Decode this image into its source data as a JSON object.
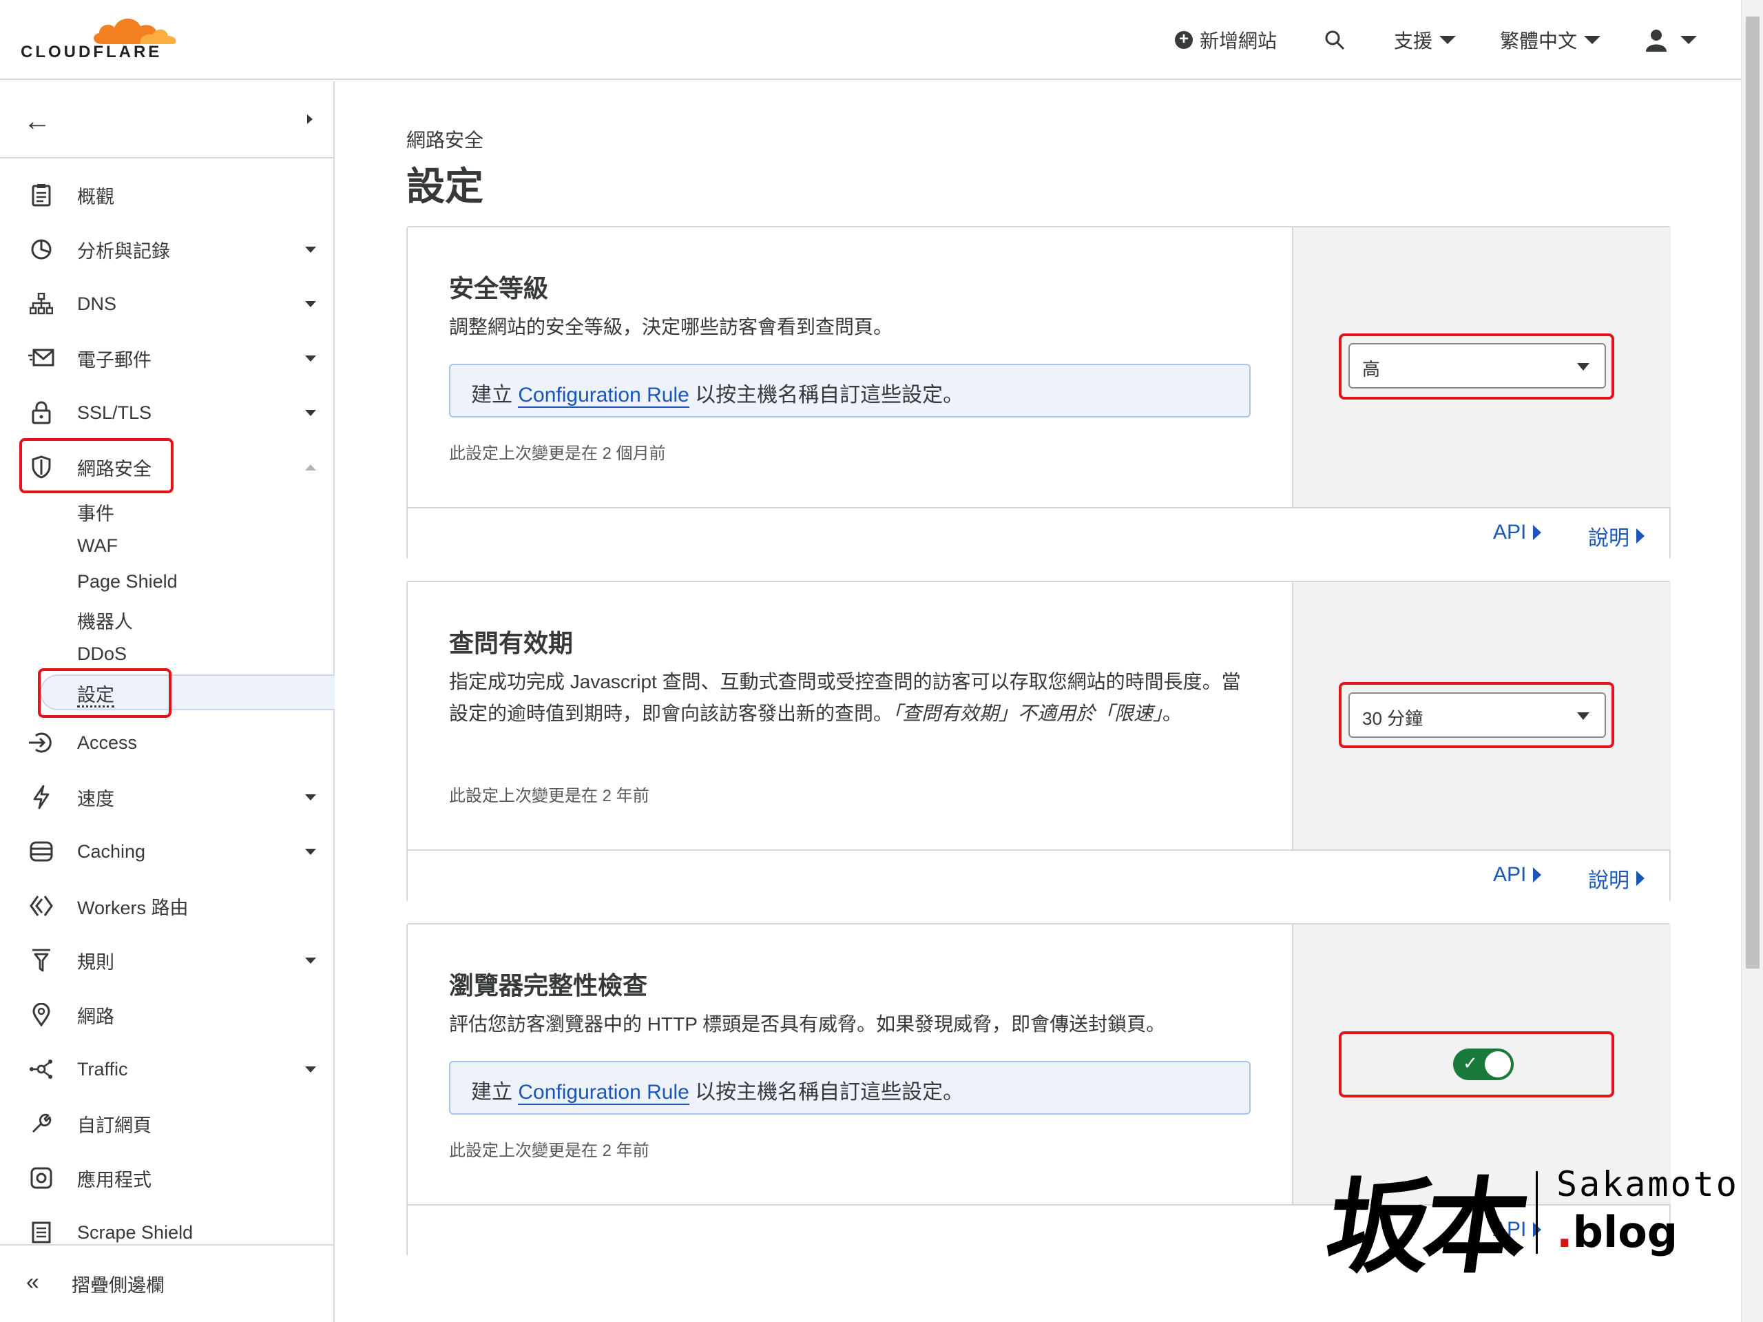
{
  "header": {
    "brand": "CLOUDFLARE",
    "add_site": "新增網站",
    "support": "支援",
    "language": "繁體中文"
  },
  "sidebar": {
    "items": [
      {
        "label": "概觀",
        "icon": "clipboard-icon"
      },
      {
        "label": "分析與記錄",
        "icon": "chart-pie-icon"
      },
      {
        "label": "DNS",
        "icon": "network-icon"
      },
      {
        "label": "電子郵件",
        "icon": "mail-icon"
      },
      {
        "label": "SSL/TLS",
        "icon": "lock-icon"
      },
      {
        "label": "網路安全",
        "icon": "shield-icon"
      },
      {
        "label": "Access",
        "icon": "access-icon"
      },
      {
        "label": "速度",
        "icon": "lightning-icon"
      },
      {
        "label": "Caching",
        "icon": "storage-icon"
      },
      {
        "label": "Workers 路由",
        "icon": "workers-icon"
      },
      {
        "label": "規則",
        "icon": "filter-icon"
      },
      {
        "label": "網路",
        "icon": "location-pin-icon"
      },
      {
        "label": "Traffic",
        "icon": "traffic-icon"
      },
      {
        "label": "自訂網頁",
        "icon": "wrench-icon"
      },
      {
        "label": "應用程式",
        "icon": "apps-icon"
      },
      {
        "label": "Scrape Shield",
        "icon": "document-icon"
      }
    ],
    "security_subitems": [
      "事件",
      "WAF",
      "Page Shield",
      "機器人",
      "DDoS",
      "設定"
    ],
    "collapse_label": "摺疊側邊欄"
  },
  "main": {
    "breadcrumb": "網路安全",
    "title": "設定",
    "cards": [
      {
        "title": "安全等級",
        "description": "調整網站的安全等級，決定哪些訪客會看到查問頁。",
        "info_prefix": "建立",
        "info_link": "Configuration Rule",
        "info_suffix": "以按主機名稱自訂這些設定。",
        "last_changed": "此設定上次變更是在 2 個月前",
        "control_value": "高",
        "api_label": "API",
        "help_label": "說明"
      },
      {
        "title": "查問有效期",
        "description": "指定成功完成 Javascript 查問、互動式查問或受控查問的訪客可以存取您網站的時間長度。當設定的逾時值到期時，即會向該訪客發出新的查問。",
        "description_italic": "「查問有效期」不適用於「限速」",
        "description_end": "。",
        "last_changed": "此設定上次變更是在 2 年前",
        "control_value": "30 分鐘",
        "api_label": "API",
        "help_label": "說明"
      },
      {
        "title": "瀏覽器完整性檢查",
        "description": "評估您訪客瀏覽器中的 HTTP 標頭是否具有威脅。如果發現威脅，即會傳送封鎖頁。",
        "info_prefix": "建立",
        "info_link": "Configuration Rule",
        "info_suffix": "以按主機名稱自訂這些設定。",
        "last_changed": "此設定上次變更是在 2 年前",
        "toggle_on": true,
        "api_label": "API"
      }
    ]
  },
  "watermark": {
    "kanji": "坂本",
    "name": "Sakamoto",
    "dot": ".",
    "blog": "blog"
  },
  "colors": {
    "accent_link": "#1a56b8",
    "highlight_box": "#e3121b",
    "toggle_on": "#1a7a3a",
    "brand_orange": "#f38020"
  }
}
